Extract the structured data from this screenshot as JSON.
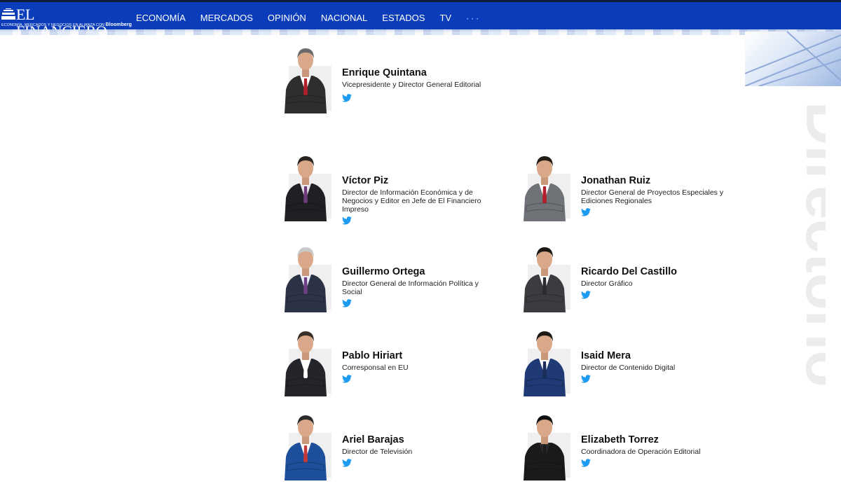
{
  "brand": {
    "name": "EL FINANCIERO",
    "tagline_prefix": "ECONOMÍA, MERCADOS Y NEGOCIOS EN ALIANZA CON",
    "tagline_partner": "Bloomberg",
    "primary_color": "#0b3dbb",
    "twitter_color": "#1d9bf0"
  },
  "nav": {
    "items": [
      {
        "label": "ECONOMÍA"
      },
      {
        "label": "MERCADOS"
      },
      {
        "label": "OPINIÓN"
      },
      {
        "label": "NACIONAL"
      },
      {
        "label": "ESTADOS"
      },
      {
        "label": "TV"
      }
    ],
    "more_label": "···"
  },
  "page": {
    "title": "Directorio"
  },
  "people": [
    {
      "name": "Enrique Quintana",
      "role": "Vicepresidente y Director General Editorial",
      "twitter_icon": "twitter-icon",
      "suit": "#2e2e2e",
      "tie": "#b11f2a",
      "hair": "#6a6a6a",
      "shirt": "#ffffff"
    },
    {
      "name": "Víctor Piz",
      "role": "Director de Información Económica y de Negocios y Editor en Jefe de El Financiero Impreso",
      "twitter_icon": "twitter-icon",
      "suit": "#1f2024",
      "tie": "#6d3b7a",
      "hair": "#2a2420",
      "shirt": "#e9e9ee"
    },
    {
      "name": "Jonathan Ruiz",
      "role": "Director General de Proyectos Especiales y Ediciones Regionales",
      "twitter_icon": "twitter-icon",
      "suit": "#6f7377",
      "tie": "#b51d2b",
      "hair": "#241c17",
      "shirt": "#ffffff"
    },
    {
      "name": "Guillermo Ortega",
      "role": "Director General de Información Política y Social",
      "twitter_icon": "twitter-icon",
      "suit": "#2b3345",
      "tie": "#6b3f82",
      "hair": "#c9c9c9",
      "shirt": "#e8edf7"
    },
    {
      "name": "Ricardo Del Castillo",
      "role": "Director Gráfico",
      "twitter_icon": "twitter-icon",
      "suit": "#3a3c40",
      "tie": "#2a2b2e",
      "hair": "#1c1714",
      "shirt": "#ffffff"
    },
    {
      "name": "Pablo Hiriart",
      "role": "Corresponsal en EU",
      "twitter_icon": "twitter-icon",
      "suit": "#23252a",
      "tie": "#ffffff",
      "hair": "#3a2f28",
      "shirt": "#ffffff"
    },
    {
      "name": "Isaid Mera",
      "role": "Director de Contenido Digital",
      "twitter_icon": "twitter-icon",
      "suit": "#1f3a75",
      "tie": "#1c2f5a",
      "hair": "#1f1915",
      "shirt": "#ffffff"
    },
    {
      "name": "Ariel Barajas",
      "role": "Director de Televisión",
      "twitter_icon": "twitter-icon",
      "suit": "#1e4f9a",
      "tie": "#c43a3a",
      "hair": "#2b2b2b",
      "shirt": "#ffffff"
    },
    {
      "name": "Elizabeth Torrez",
      "role": "Coordinadora de Operación Editorial",
      "twitter_icon": "twitter-icon",
      "suit": "#1a1a1c",
      "tie": "#1a1a1c",
      "hair": "#111111",
      "shirt": "#2a2a2c"
    }
  ]
}
